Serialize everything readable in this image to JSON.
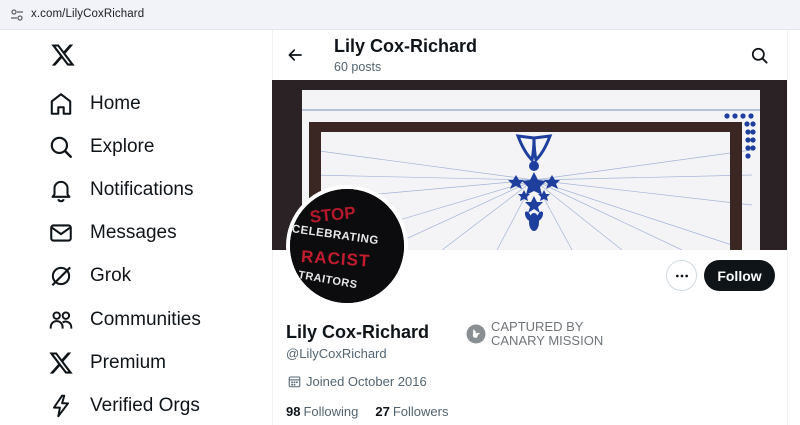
{
  "browser": {
    "url": "x.com/LilyCoxRichard"
  },
  "nav": {
    "items": [
      {
        "label": "Home",
        "icon": "home-icon"
      },
      {
        "label": "Explore",
        "icon": "search-icon"
      },
      {
        "label": "Notifications",
        "icon": "bell-icon"
      },
      {
        "label": "Messages",
        "icon": "envelope-icon"
      },
      {
        "label": "Grok",
        "icon": "grok-icon"
      },
      {
        "label": "Communities",
        "icon": "people-icon"
      },
      {
        "label": "Premium",
        "icon": "x-logo-icon"
      },
      {
        "label": "Verified Orgs",
        "icon": "lightning-icon"
      }
    ]
  },
  "header": {
    "title": "Lily Cox-Richard",
    "posts": "60 posts"
  },
  "avatar_text": {
    "line1": "STOP",
    "line2": "CELEBRATING",
    "line3": "RACIST",
    "line4": "TRAITORS"
  },
  "profile": {
    "name": "Lily Cox-Richard",
    "handle": "@LilyCoxRichard",
    "joined": "Joined October 2016",
    "following_count": "98",
    "following_label": "Following",
    "followers_count": "27",
    "followers_label": "Followers",
    "follow_label": "Follow",
    "badge_line1": "CAPTURED BY",
    "badge_line2": "CANARY MISSION"
  },
  "colors": {
    "follow_bg": "#0f1419",
    "banner_frame": "#3a2622",
    "banner_blue": "#1f3f9e"
  }
}
